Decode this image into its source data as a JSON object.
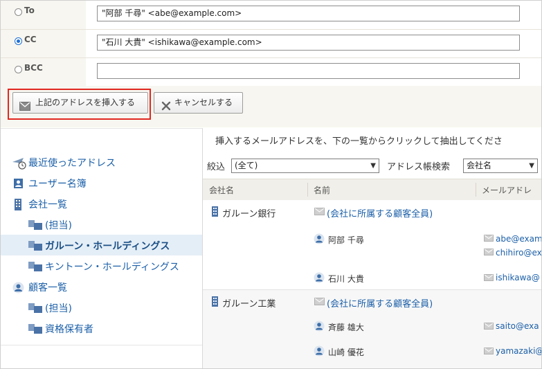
{
  "recipients": [
    {
      "label": "To",
      "value": "\"阿部 千尋\" <abe@example.com>",
      "selected": false
    },
    {
      "label": "CC",
      "value": "\"石川 大貴\" <ishikawa@example.com>",
      "selected": true
    },
    {
      "label": "BCC",
      "value": "",
      "selected": false
    }
  ],
  "actions": {
    "insert_label": "上記のアドレスを挿入する",
    "cancel_label": "キャンセルする"
  },
  "nav": [
    {
      "label": "最近使ったアドレス",
      "icon": "recent-address-icon",
      "level": 0
    },
    {
      "label": "ユーザー名簿",
      "icon": "user-directory-icon",
      "level": 0
    },
    {
      "label": "会社一覧",
      "icon": "company-building-icon",
      "level": 0
    },
    {
      "label": "(担当)",
      "icon": "folder-icon",
      "level": 1
    },
    {
      "label": "ガルーン・ホールディングス",
      "icon": "folder-icon",
      "level": 1,
      "selected": true
    },
    {
      "label": "キントーン・ホールディングス",
      "icon": "folder-icon",
      "level": 1
    },
    {
      "label": "顧客一覧",
      "icon": "customer-icon",
      "level": 0
    },
    {
      "label": "(担当)",
      "icon": "folder-icon",
      "level": 1
    },
    {
      "label": "資格保有者",
      "icon": "folder-icon",
      "level": 1
    }
  ],
  "main": {
    "hint": "挿入するメールアドレスを、下の一覧からクリックして抽出してくださ",
    "filter_label": "絞込",
    "filter_value": "(全て)",
    "search_label": "アドレス帳検索",
    "search_value": "会社名",
    "columns": [
      "会社名",
      "名前",
      "メールアドレ"
    ],
    "groups": [
      {
        "company": "ガルーン銀行",
        "all_customers": "(会社に所属する顧客全員)",
        "people": [
          {
            "name": "阿部 千尋",
            "emails": [
              "abe@exam",
              "chihiro@ex"
            ]
          },
          {
            "name": "石川 大貴",
            "emails": [
              "ishikawa@"
            ]
          }
        ]
      },
      {
        "company": "ガルーン工業",
        "all_customers": "(会社に所属する顧客全員)",
        "people": [
          {
            "name": "斉藤 雄大",
            "emails": [
              "saito@exa"
            ]
          },
          {
            "name": "山崎 優花",
            "emails": [
              "yamazaki@"
            ]
          }
        ]
      }
    ]
  },
  "colors": {
    "accent": "#1b5fa8",
    "highlight_border": "#e0271f",
    "radio_on": "#1f6fd6",
    "selected_bg": "#e4eef6"
  }
}
